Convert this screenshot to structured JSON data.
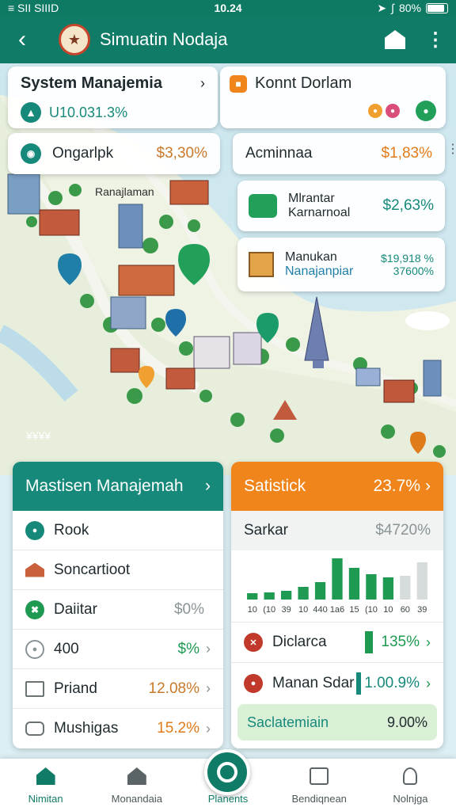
{
  "status": {
    "carrier": "≡ SII SIIID",
    "time": "10.24",
    "battery": "80%"
  },
  "app": {
    "title": "Simuatin Nodaja"
  },
  "overlay": {
    "system_card": {
      "title": "System Manajemia",
      "value": "U10.031.3%"
    },
    "kont_card": {
      "title": "Konnt Dorlam"
    },
    "ongarlpk": {
      "label": "Ongarlpk",
      "value": "$3,30%"
    },
    "admin": {
      "label": "Acminnaa",
      "value": "$1,83%"
    },
    "mlrantar": {
      "label1": "Mlrantar",
      "label2": "Karnarnoal",
      "value": "$2,63%"
    },
    "manukan": {
      "label1": "Manukan",
      "label2": "Nanajanpiar",
      "value1": "$19,918 %",
      "value2": "37600%"
    },
    "map_label_1": "Ranajlaman",
    "map_label_2": "¥¥¥¥",
    "map_label_3": "¥¥¥¥"
  },
  "left_panel": {
    "title": "Mastisen Manajemah",
    "items": [
      {
        "label": "Rook",
        "value": "",
        "icon": "target-icon"
      },
      {
        "label": "Soncartioot",
        "value": "",
        "icon": "building-icon"
      },
      {
        "label": "Daiitar",
        "value": "$0%",
        "icon": "chart-icon"
      },
      {
        "label": "400",
        "value": "$%",
        "icon": "gear-icon"
      },
      {
        "label": "Priand",
        "value": "12.08%",
        "icon": "shop-icon"
      },
      {
        "label": "Mushigas",
        "value": "15.2%",
        "icon": "bus-icon"
      }
    ]
  },
  "right_panel": {
    "title": "Satistick",
    "title_value": "23.7%",
    "sub_label": "Sarkar",
    "sub_value": "$4720%",
    "chart_ticks": [
      "10",
      "(10",
      "39",
      "10",
      "440",
      "1a6",
      "15",
      "(10",
      "10",
      "60",
      "39"
    ],
    "items": [
      {
        "label": "Diclarca",
        "value": "135%",
        "icon": "warning-icon"
      },
      {
        "label": "Manan Sdar",
        "value": "1.00.9%",
        "icon": "user-icon"
      }
    ],
    "footer": {
      "label": "Saclatemiain",
      "value": "9.00%"
    }
  },
  "chart_data": {
    "type": "bar",
    "categories": [
      "10",
      "(10",
      "39",
      "10",
      "440",
      "1a6",
      "15",
      "(10",
      "10",
      "60",
      "39"
    ],
    "values": [
      8,
      9,
      11,
      16,
      22,
      52,
      40,
      32,
      28,
      30,
      47
    ]
  },
  "nav": {
    "items": [
      {
        "label": "Nimitan"
      },
      {
        "label": "Monandaia"
      },
      {
        "label": "Planents"
      },
      {
        "label": "Bendiqnean"
      },
      {
        "label": "Nolnjga"
      }
    ]
  },
  "colors": {
    "primary": "#107b66",
    "orange": "#f0851c",
    "green": "#1f9a52",
    "gray_bar": "#d6dbdc"
  }
}
